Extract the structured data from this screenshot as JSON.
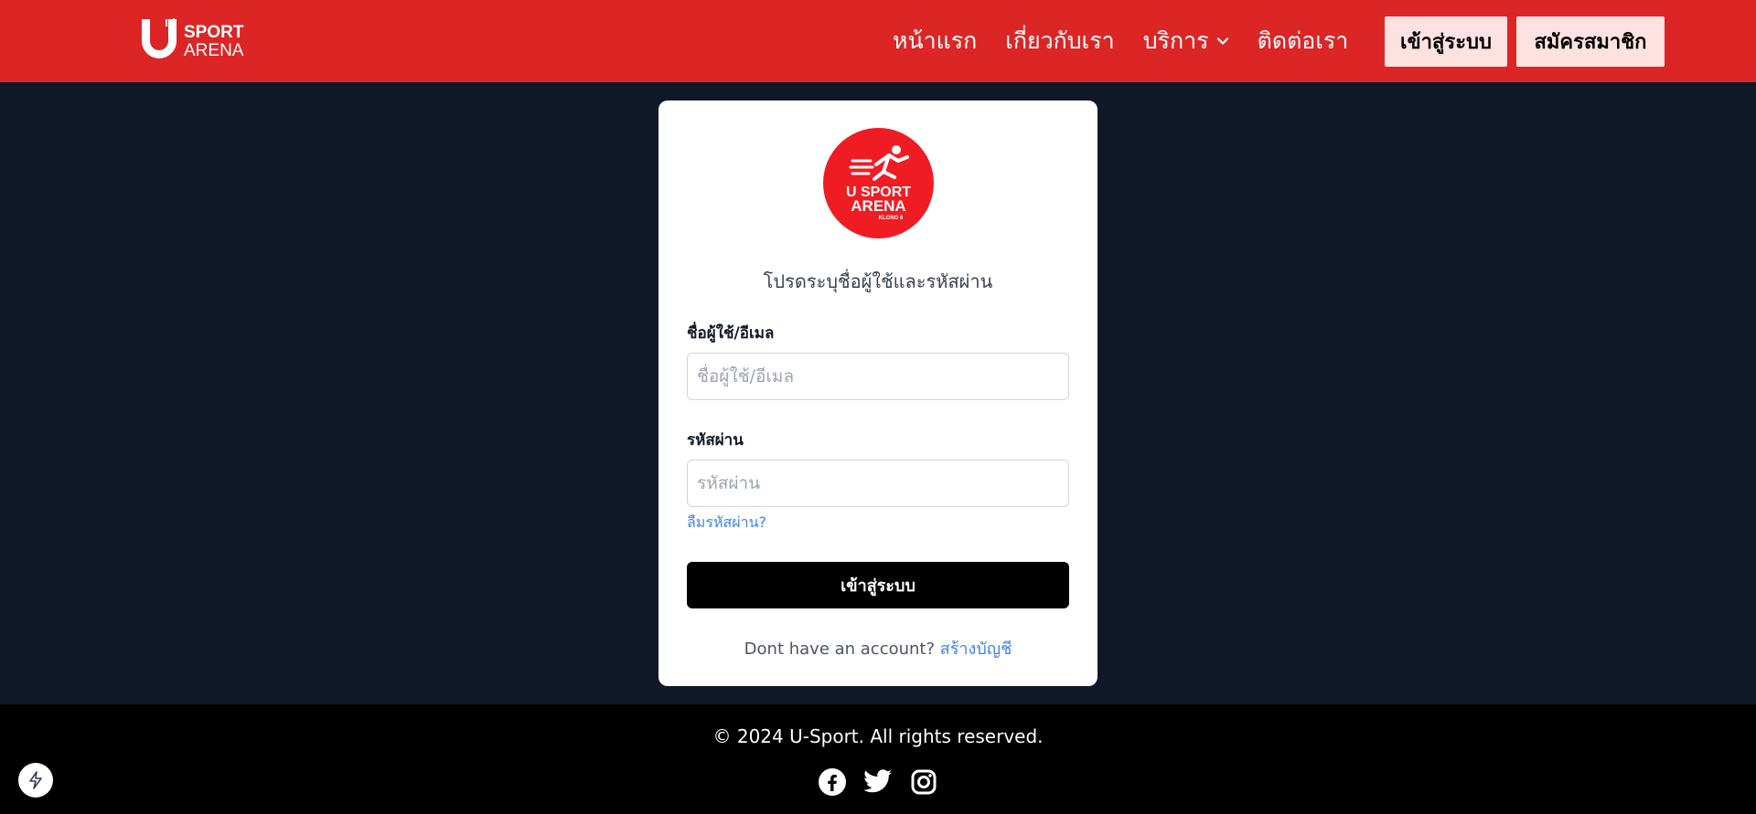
{
  "header": {
    "logo": {
      "line1": "SPORT",
      "line2": "ARENA",
      "mark": "U"
    },
    "nav": [
      {
        "label": "หน้าแรก"
      },
      {
        "label": "เกี่ยวกับเรา"
      },
      {
        "label": "บริการ",
        "icon": "chevron-down-icon"
      },
      {
        "label": "ติดต่อเรา"
      }
    ],
    "login_label": "เข้าสู่ระบบ",
    "register_label": "สมัครสมาชิก",
    "background_color": "#dc2626"
  },
  "card": {
    "logo": {
      "line1": "U SPORT",
      "line2": "ARENA",
      "line3": "KLONG 6",
      "color": "#ef1c24"
    },
    "subtitle": "โปรดระบุชื่อผู้ใช้และรหัสผ่าน",
    "username": {
      "label": "ชื่อผู้ใช้/อีเมล",
      "placeholder": "ชื่อผู้ใช้/อีเมล",
      "value": ""
    },
    "password": {
      "label": "รหัสผ่าน",
      "placeholder": "รหัสผ่าน",
      "value": ""
    },
    "forgot_label": "ลืมรหัสผ่าน?",
    "submit_label": "เข้าสู่ระบบ",
    "signup_prompt": "Dont have an account?",
    "signup_link": "สร้างบัญชี"
  },
  "footer": {
    "copyright": "© 2024 U-Sport. All rights reserved.",
    "socials": [
      {
        "icon": "facebook-icon"
      },
      {
        "icon": "twitter-icon"
      },
      {
        "icon": "instagram-icon"
      }
    ]
  },
  "badge_icon": "bolt-icon"
}
